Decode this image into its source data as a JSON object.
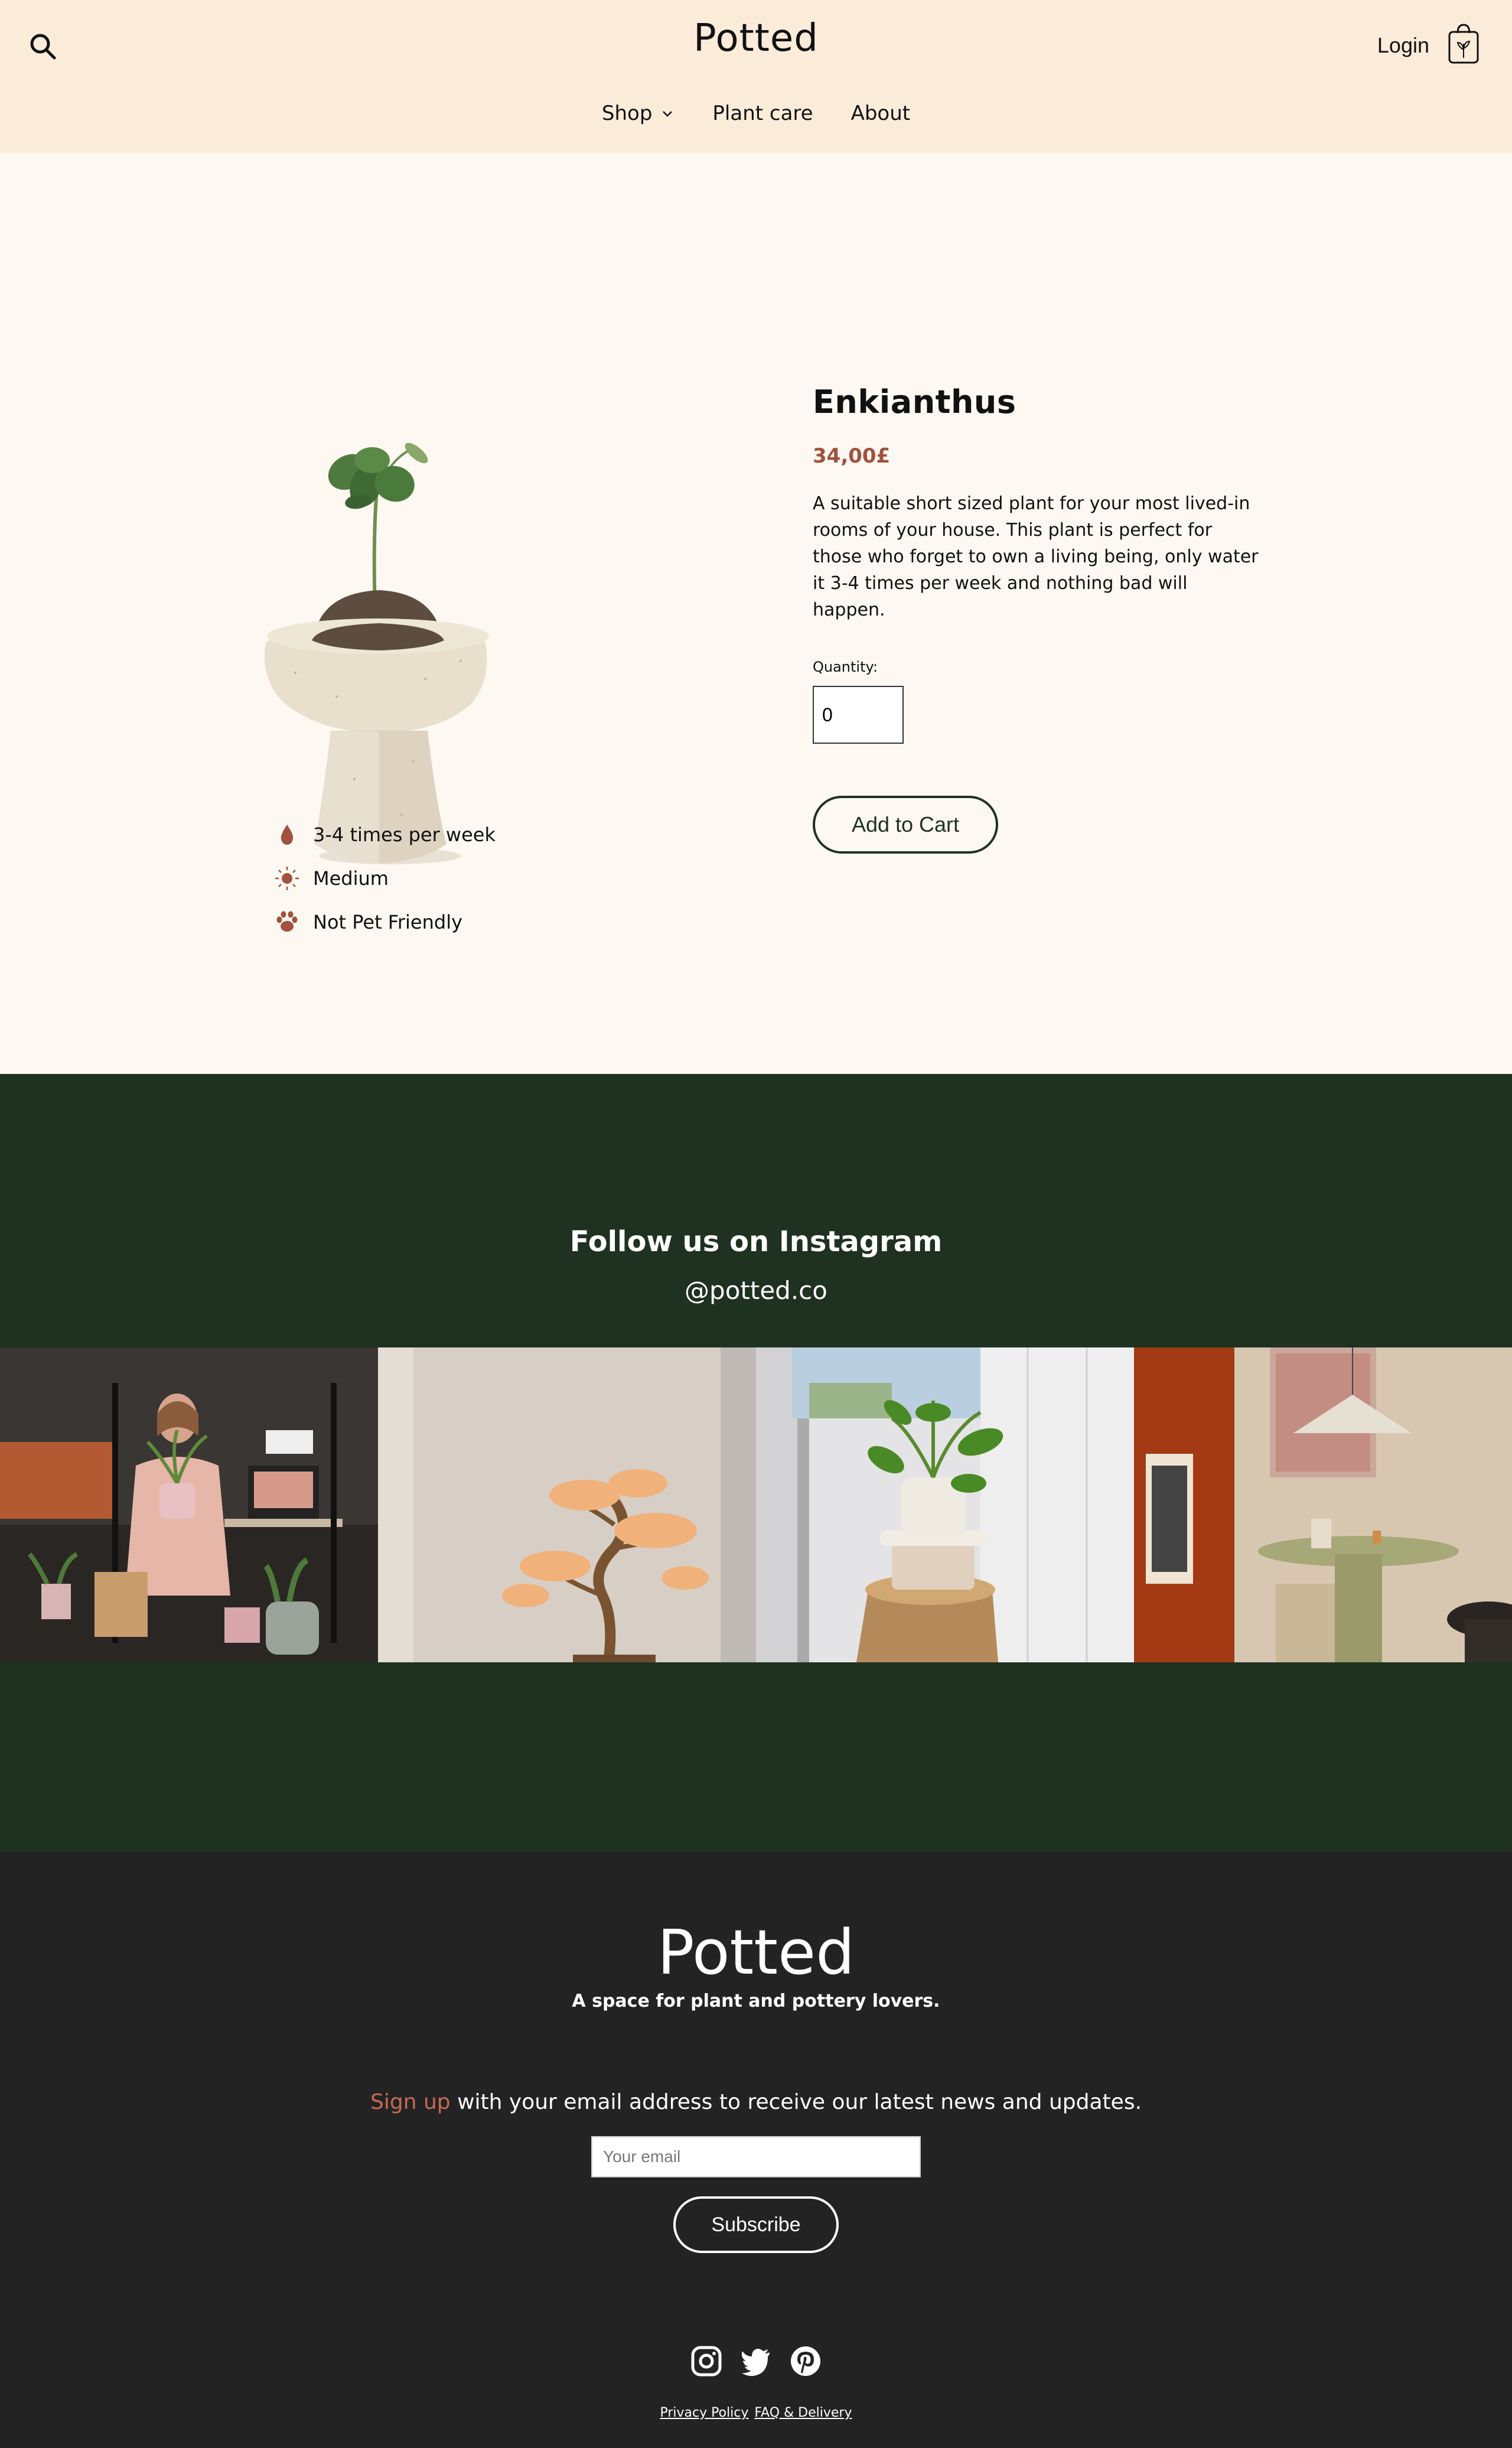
{
  "header": {
    "logo": "Potted",
    "login_label": "Login",
    "search_icon": "search-icon",
    "cart_icon": "shopping-bag-icon",
    "nav": [
      {
        "label": "Shop",
        "has_dropdown": true
      },
      {
        "label": "Plant care"
      },
      {
        "label": "About"
      }
    ]
  },
  "product": {
    "name": "Enkianthus",
    "price": "34,00£",
    "description": "A suitable short sized plant for your most lived-in rooms of your house. This plant is perfect for those who forget to own a living being, only water it 3-4 times per week and nothing bad will happen.",
    "quantity_label": "Quantity:",
    "quantity_value": "0",
    "add_to_cart_label": "Add to Cart",
    "care": [
      {
        "icon": "water-drop-icon",
        "label": "3-4 times per week"
      },
      {
        "icon": "sun-icon",
        "label": "Medium"
      },
      {
        "icon": "paw-icon",
        "label": "Not Pet Friendly"
      }
    ]
  },
  "instagram": {
    "title": "Follow us on Instagram",
    "handle": "@potted.co",
    "photos": [
      {
        "subject": "woman holding potted plant in studio"
      },
      {
        "subject": "bonsai tree on table"
      },
      {
        "subject": "potted plant by window on wooden stool"
      },
      {
        "subject": "dining room with green table and lamp"
      }
    ]
  },
  "footer": {
    "logo": "Potted",
    "tagline": "A space for plant and pottery lovers.",
    "signup_accent": "Sign up",
    "signup_text": " with your email address to receive our latest news and updates.",
    "email_placeholder": "Your email",
    "subscribe_label": "Subscribe",
    "socials": [
      "instagram-icon",
      "twitter-icon",
      "pinterest-icon"
    ],
    "links": [
      "Privacy Policy",
      "FAQ & Delivery"
    ]
  },
  "colors": {
    "header_bg": "#fbebd9",
    "page_bg": "#fdf8f1",
    "accent": "#a0523f",
    "instagram_bg": "#1f3121",
    "footer_bg": "#232323"
  }
}
